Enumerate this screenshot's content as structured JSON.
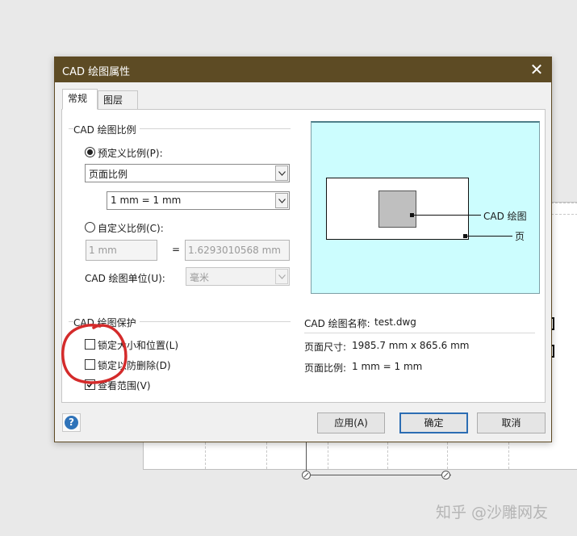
{
  "dialog": {
    "title": "CAD 绘图属性",
    "close_icon": "close-icon",
    "tabs": [
      {
        "label": "常规"
      },
      {
        "label": "图层"
      }
    ],
    "scale_group": {
      "title": "CAD 绘图比例",
      "predefined_label": "预定义比例(P):",
      "predefined_select": "页面比例",
      "predefined_value_select": "1 mm = 1 mm",
      "custom_label": "自定义比例(C):",
      "custom_left": "1 mm",
      "equals": "=",
      "custom_right": "1.6293010568 mm",
      "unit_label": "CAD 绘图单位(U):",
      "unit_value": "毫米"
    },
    "protect_group": {
      "title": "CAD 绘图保护",
      "lock_size": "锁定大小和位置(L)",
      "lock_delete": "锁定以防删除(D)",
      "view_range": "查看范围(V)"
    },
    "preview": {
      "cad_label": "CAD 绘图",
      "page_label": "页"
    },
    "info": {
      "name_label": "CAD 绘图名称:",
      "name_value": "test.dwg",
      "size_label": "页面尺寸:",
      "size_value": "1985.7 mm x 865.6 mm",
      "scale_label": "页面比例:",
      "scale_value": "1 mm = 1 mm"
    },
    "buttons": {
      "help": "?",
      "apply": "应用(A)",
      "ok": "确定",
      "cancel": "取消"
    }
  },
  "watermark": "知乎 @沙雕网友",
  "annotation_color": "#d42b2b",
  "accent_color": "#2c6db3",
  "title_bar_color": "#5d4b24"
}
